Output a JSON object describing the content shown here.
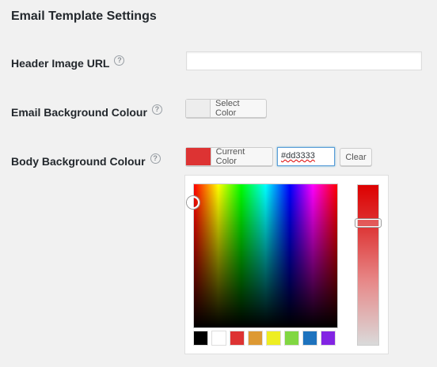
{
  "page": {
    "title": "Email Template Settings"
  },
  "fields": {
    "header_image": {
      "label": "Header Image URL",
      "value": "",
      "help": "?"
    },
    "email_bg": {
      "label": "Email Background Colour",
      "button_label": "Select Color",
      "swatch_color": "#ededed",
      "help": "?"
    },
    "body_bg": {
      "label": "Body Background Colour",
      "button_label": "Current Color",
      "hex_value": "#dd3333",
      "clear_label": "Clear",
      "swatch_color": "#dd3333",
      "help": "?"
    }
  },
  "palette": [
    "#000000",
    "#ffffff",
    "#dd3333",
    "#dd9933",
    "#eeee22",
    "#81d742",
    "#1e73be",
    "#8224e3"
  ]
}
